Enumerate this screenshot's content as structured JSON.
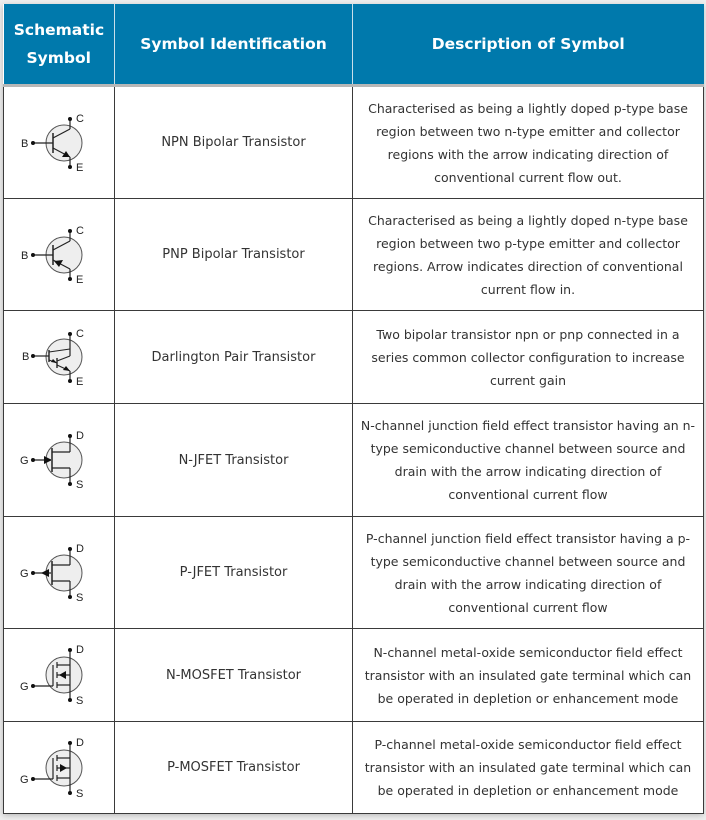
{
  "colors": {
    "header_bg": "#0079ac",
    "header_text": "#ffffff",
    "body_text": "#333333",
    "border": "#3a3a3a",
    "symbol_fill": "#eeeeee"
  },
  "table": {
    "headers": [
      "Schematic Symbol",
      "Symbol Identification",
      "Description of Symbol"
    ],
    "rows": [
      {
        "symbol_icon": "npn-transistor-icon",
        "terminals": [
          "B",
          "C",
          "E"
        ],
        "identification": "NPN Bipolar Transistor",
        "description": "Characterised as being a lightly doped p-type base region between two n-type emitter and collector regions with the arrow indicating direction of conventional current flow out."
      },
      {
        "symbol_icon": "pnp-transistor-icon",
        "terminals": [
          "B",
          "C",
          "E"
        ],
        "identification": "PNP Bipolar Transistor",
        "description": "Characterised as being a lightly doped n-type base region between two p-type emitter and collector regions. Arrow indicates direction of conventional current flow in."
      },
      {
        "symbol_icon": "darlington-pair-icon",
        "terminals": [
          "B",
          "C",
          "E"
        ],
        "identification": "Darlington Pair Transistor",
        "description": "Two bipolar transistor npn or pnp connected in a series common collector configuration to increase current gain"
      },
      {
        "symbol_icon": "n-jfet-icon",
        "terminals": [
          "G",
          "D",
          "S"
        ],
        "identification": "N-JFET Transistor",
        "description": "N-channel junction field effect transistor having an n-type semiconductive channel between source and drain with the arrow indicating direction of conventional current flow"
      },
      {
        "symbol_icon": "p-jfet-icon",
        "terminals": [
          "G",
          "D",
          "S"
        ],
        "identification": "P-JFET Transistor",
        "description": "P-channel junction field effect transistor having a p-type semiconductive channel between source and drain with the arrow indicating direction of conventional current flow"
      },
      {
        "symbol_icon": "n-mosfet-icon",
        "terminals": [
          "G",
          "D",
          "S"
        ],
        "identification": "N-MOSFET Transistor",
        "description": "N-channel metal-oxide semiconductor field effect transistor with an insulated gate terminal which can be operated in depletion or enhancement mode"
      },
      {
        "symbol_icon": "p-mosfet-icon",
        "terminals": [
          "G",
          "D",
          "S"
        ],
        "identification": "P-MOSFET Transistor",
        "description": "P-channel metal-oxide semiconductor field effect transistor with an insulated gate terminal which can be operated in depletion or enhancement mode"
      }
    ]
  }
}
